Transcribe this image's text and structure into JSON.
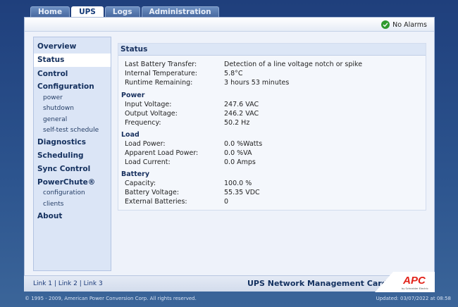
{
  "tabs": [
    "Home",
    "UPS",
    "Logs",
    "Administration"
  ],
  "alarm": {
    "label": "No Alarms",
    "icon": "check-circle-icon",
    "color": "#2f9a2f"
  },
  "sidebar": {
    "items": [
      {
        "label": "Overview"
      },
      {
        "label": "Status",
        "active": true
      },
      {
        "label": "Control"
      },
      {
        "label": "Configuration"
      },
      {
        "label": "power"
      },
      {
        "label": "shutdown"
      },
      {
        "label": "general"
      },
      {
        "label": "self-test schedule"
      },
      {
        "label": "Diagnostics"
      },
      {
        "label": "Scheduling"
      },
      {
        "label": "Sync Control"
      },
      {
        "label": "PowerChute®"
      },
      {
        "label": "configuration"
      },
      {
        "label": "clients"
      },
      {
        "label": "About"
      }
    ]
  },
  "status": {
    "title": "Status",
    "rows": [
      {
        "label": "Last Battery Transfer:",
        "value": "Detection of a line voltage notch or spike"
      },
      {
        "label": "Internal Temperature:",
        "value": "5.8°C"
      },
      {
        "label": "Runtime Remaining:",
        "value": "3 hours 53 minutes"
      }
    ],
    "power": {
      "title": "Power",
      "rows": [
        {
          "label": "Input Voltage:",
          "value": "247.6 VAC"
        },
        {
          "label": "Output Voltage:",
          "value": "246.2 VAC"
        },
        {
          "label": "Frequency:",
          "value": "50.2 Hz"
        }
      ]
    },
    "load": {
      "title": "Load",
      "rows": [
        {
          "label": "Load Power:",
          "value": "0.0 %Watts"
        },
        {
          "label": "Apparent Load Power:",
          "value": "0.0 %VA"
        },
        {
          "label": "Load Current:",
          "value": "0.0 Amps"
        }
      ]
    },
    "battery": {
      "title": "Battery",
      "rows": [
        {
          "label": "Capacity:",
          "value": "100.0 %"
        },
        {
          "label": "Battery Voltage:",
          "value": "55.35 VDC"
        },
        {
          "label": "External Batteries:",
          "value": "0"
        }
      ]
    }
  },
  "footer": {
    "links": [
      "Link 1",
      "Link 2",
      "Link 3"
    ],
    "separator": "|",
    "card_title": "UPS Network Management Card",
    "logo_text": "APC",
    "logo_sub": "by Schneider Electric",
    "copyright": "© 1995 - 2009, American Power Conversion Corp. All rights reserved.",
    "updated": "Updated: 03/07/2022 at 08:58"
  },
  "colors": {
    "brand_red": "#e2231a",
    "nav_text": "#14305e",
    "background_blue": "#2d558f"
  }
}
